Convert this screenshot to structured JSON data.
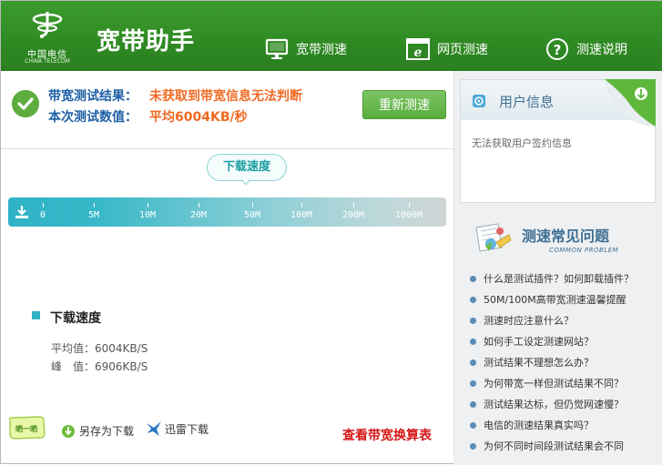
{
  "header": {
    "logo_cn": "中国电信",
    "logo_en": "CHINA TELECOM",
    "title": "宽带助手",
    "nav": [
      {
        "label": "宽带测速",
        "icon": "monitor-icon"
      },
      {
        "label": "网页测速",
        "icon": "browser-icon"
      },
      {
        "label": "测速说明",
        "icon": "help-icon"
      }
    ]
  },
  "result": {
    "label_1": "带宽测试结果：",
    "value_1": "未获取到带宽信息无法判断",
    "label_2": "本次测试数值：",
    "value_2": "平均6004KB/秒",
    "retest_label": "重新测速"
  },
  "speed": {
    "tag": "下载速度",
    "scale_labels": [
      "0",
      "5M",
      "10M",
      "20M",
      "50M",
      "100M",
      "200M",
      "1000M"
    ]
  },
  "stats": {
    "title": "下载速度",
    "avg_label": "平均值：",
    "avg_value": "6004KB/S",
    "peak_label": "峰　值：",
    "peak_value": "6906KB/S"
  },
  "bottom": {
    "share_badge": "晒一晒",
    "save_download": "另存为下载",
    "thunder_download": "迅雷下载",
    "conversion_link": "查看带宽换算表"
  },
  "user_panel": {
    "title": "用户信息",
    "text": "无法获取用户签约信息"
  },
  "faq": {
    "title": "测速常见问题",
    "subtitle": "COMMON PROBLEM",
    "items": [
      "什么是测试插件？如何卸载插件？",
      "50M/100M高带宽测速温馨提醒",
      "测速时应注意什么？",
      "如何手工设定测速网站？",
      "测试结果不理想怎么办？",
      "为何带宽一样但测试结果不同？",
      "测试结果达标，但仍觉网速慢？",
      "电信的测速结果真实吗？",
      "为何不同时间段测试结果会不同"
    ]
  },
  "colors": {
    "header_green": "#2f8a23",
    "accent_teal": "#2fb3c6",
    "result_orange": "#ef6a23",
    "label_blue": "#1e5fa6",
    "link_red": "#d41818"
  }
}
